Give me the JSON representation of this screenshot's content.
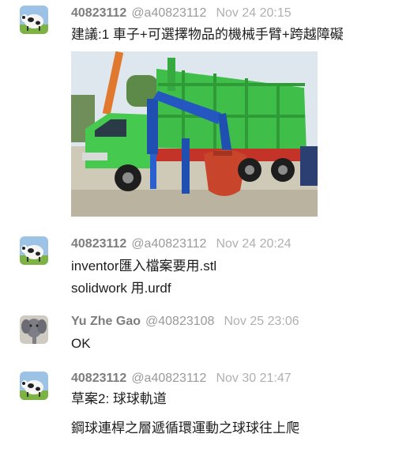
{
  "messages": [
    {
      "author": "40823112",
      "handle": "@a40823112",
      "time": "Nov 24 20:15",
      "avatar_icon": "cow-avatar-icon",
      "lines": [
        "建議:1 車子+可選擇物品的機械手臂+跨越障礙"
      ],
      "attachment": "truck-with-crane-arm-photo"
    },
    {
      "author": "40823112",
      "handle": "@a40823112",
      "time": "Nov 24 20:24",
      "avatar_icon": "cow-avatar-icon",
      "lines": [
        "inventor匯入檔案要用.stl",
        "solidwork 用.urdf"
      ]
    },
    {
      "author": "Yu Zhe Gao",
      "handle": "@40823108",
      "time": "Nov 25 23:06",
      "avatar_icon": "elephant-avatar-icon",
      "lines": [
        "OK"
      ]
    },
    {
      "author": "40823112",
      "handle": "@a40823112",
      "time": "Nov 30 21:47",
      "avatar_icon": "cow-avatar-icon",
      "lines": [
        "草案2: 球球軌道",
        "鋼球連桿之層遞循環運動之球球往上爬"
      ]
    }
  ],
  "colors": {
    "author": "#7d7d7d",
    "handle": "#9a9a9a",
    "time": "#b0b0b0",
    "text": "#1d1d1d",
    "truck_green": "#3fbf4a",
    "crane_blue": "#1f4fb0",
    "bucket_red": "#c8442a"
  }
}
